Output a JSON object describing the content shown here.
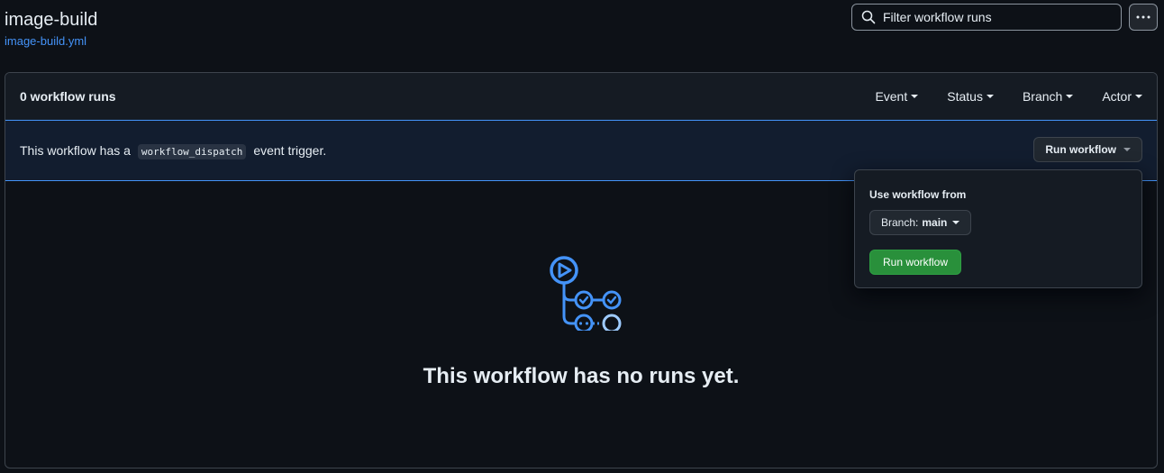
{
  "workflow": {
    "title": "image-build",
    "file": "image-build.yml"
  },
  "search": {
    "placeholder": "Filter workflow runs"
  },
  "runs_header": {
    "count_label": "0 workflow runs",
    "filters": [
      "Event",
      "Status",
      "Branch",
      "Actor"
    ]
  },
  "dispatch": {
    "text_before": "This workflow has a",
    "code": "workflow_dispatch",
    "text_after": "event trigger.",
    "run_button": "Run workflow"
  },
  "popover": {
    "label": "Use workflow from",
    "branch_prefix": "Branch:",
    "branch_value": "main",
    "submit": "Run workflow"
  },
  "empty_state": {
    "title": "This workflow has no runs yet."
  },
  "icons": {
    "search": "search-icon",
    "more": "kebab-horizontal-icon",
    "empty": "workflow-graph-icon"
  },
  "colors": {
    "accent_blue": "#4493f8",
    "success_green": "#29903b",
    "background": "#0d1117"
  }
}
